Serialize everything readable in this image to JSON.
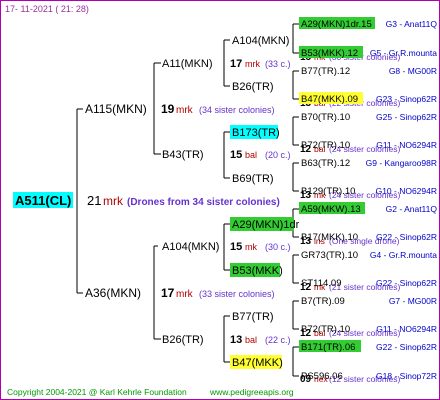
{
  "header": {
    "date": "17-  11-2021  ( 21:  28)"
  },
  "footer": {
    "copyright": "Copyright 2004-2021 @ Karl Kehrle Foundation",
    "website": "www.pedigreeapis.org"
  },
  "colors": {
    "border": "#b000b0",
    "root_bg": "#00ffff",
    "cyan": "#00ffff",
    "green": "#33cc33",
    "yellow": "#ffff33",
    "mrk": "#b00000",
    "purple": "#6633cc",
    "blue": "#0000cc",
    "footer_green": "#009900",
    "date_purple": "#993399"
  },
  "root": {
    "name": "A511(CL)",
    "count": "21",
    "mark": "mrk",
    "note": "(Drones from 34 sister colonies)"
  },
  "gen1": [
    {
      "name": "A115(MKN)",
      "count": "19",
      "mark": "mrk",
      "note": "(34 sister colonies)"
    },
    {
      "name": "A36(MKN)",
      "count": "17",
      "mark": "mrk",
      "note": "(33 sister colonies)"
    }
  ],
  "gen2": [
    {
      "name": "A11(MKN)",
      "count": "17",
      "mark": "mrk",
      "note": "(33 c.)"
    },
    {
      "name": "B43(TR)",
      "count": "15",
      "mark": "bal",
      "note": "(20 c.)"
    },
    {
      "name": "A104(MKN)",
      "count": "15",
      "mark": "mk",
      "note": "(30 c.)"
    },
    {
      "name": "B26(TR)",
      "count": "13",
      "mark": "bal",
      "note": "(22 c.)"
    }
  ],
  "gen3": [
    {
      "name": "A104(MKN)",
      "count": "15",
      "mark": "mk",
      "note": "(30 sister colonies)"
    },
    {
      "name": "B26(TR)",
      "count": "13",
      "mark": "bal",
      "note": "(22 sister colonies)"
    },
    {
      "name": "B173(TR)",
      "count": "12",
      "mark": "bal",
      "note": "(24 sister colonies)"
    },
    {
      "name": "B69(TR)",
      "count": "13",
      "mark": "mk",
      "note": "(24 sister colonies)"
    },
    {
      "name": "A29(MKN)1dr",
      "count": "13",
      "mark": "ins",
      "note": "(One single drone)"
    },
    {
      "name": "B53(MKK)",
      "count": "12",
      "mark": "mk",
      "note": "(21 sister colonies)"
    },
    {
      "name": "B77(TR)",
      "count": "12",
      "mark": "bal",
      "note": "(24 sister colonies)"
    },
    {
      "name": "B47(MKK)",
      "count": "09",
      "mark": "nex",
      "note": "(12 sister colonies)"
    }
  ],
  "gen4": [
    {
      "name": "A29(MKN)1dr.15",
      "code": "G3 - Anat11Q"
    },
    {
      "name": "B53(MKK).12",
      "code": "G5 - Gr.R.mounta"
    },
    {
      "name": "B77(TR).12",
      "code": "G8 - MG00R"
    },
    {
      "name": "B47(MKK).09",
      "code": "G23 - Sinop62R"
    },
    {
      "name": "B70(TR).10",
      "code": "G25 - Sinop62R"
    },
    {
      "name": "B72(TR).10",
      "code": "G11 - NO6294R"
    },
    {
      "name": "B63(TR).12",
      "code": "G9 - Kangaroo98R"
    },
    {
      "name": "B129(TR).10",
      "code": "G10 - NO6294R"
    },
    {
      "name": "A59(MKW).13",
      "code": "G2 - Anat11Q"
    },
    {
      "name": "B17(MKK).10",
      "code": "G22 - Sinop62R"
    },
    {
      "name": "GR73(TR).10",
      "code": "G4 - Gr.R.mounta"
    },
    {
      "name": "ST114.09",
      "code": "G22 - Sinop62R"
    },
    {
      "name": "B7(TR).09",
      "code": "G7 - MG00R"
    },
    {
      "name": "B72(TR).10",
      "code": "G11 - NO6294R"
    },
    {
      "name": "B171(TR).06",
      "code": "G22 - Sinop62R"
    },
    {
      "name": "PS596.06",
      "code": "G18 - Sinop72R"
    }
  ]
}
